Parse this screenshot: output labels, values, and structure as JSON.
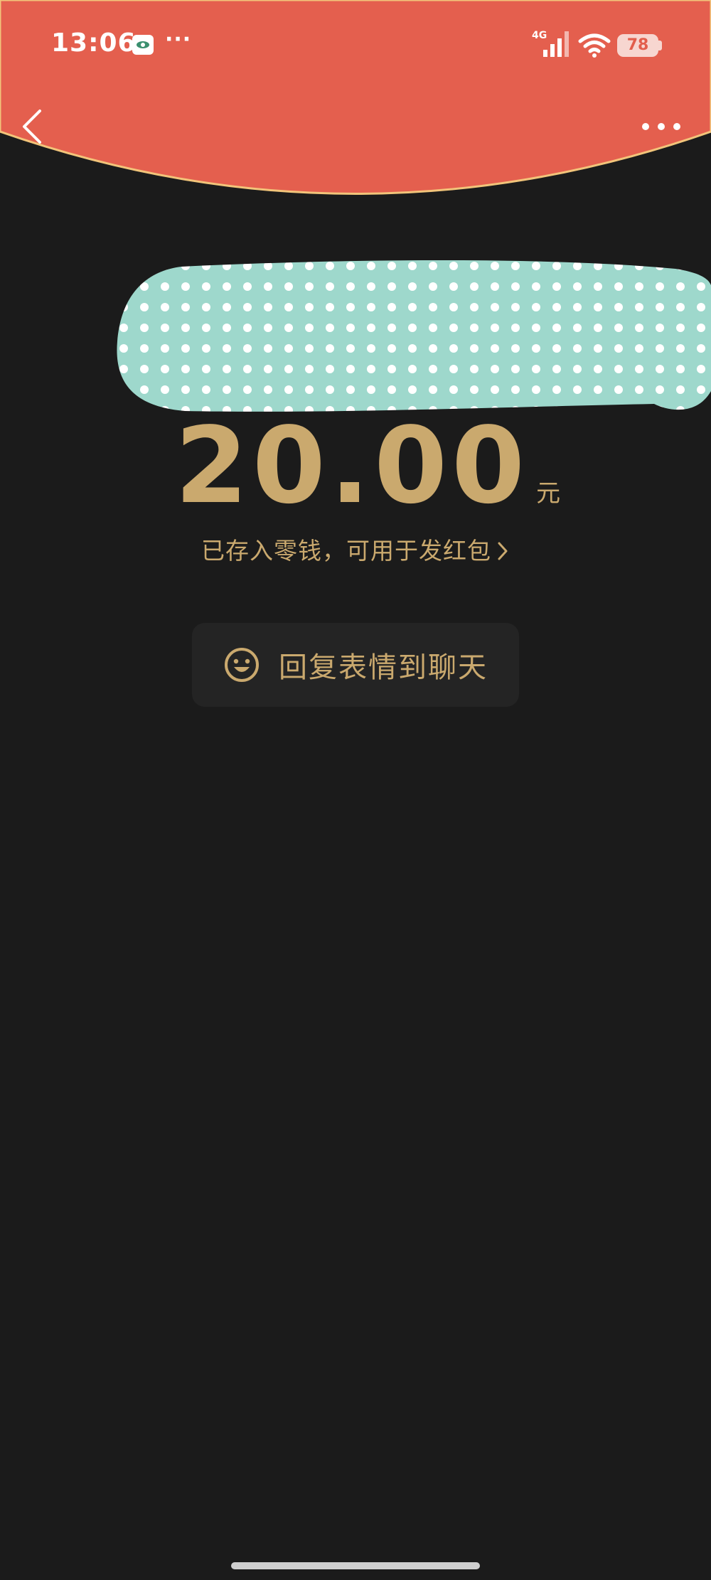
{
  "status_bar": {
    "time": "13:06",
    "app_icon": "message-app-icon",
    "more_dots": "···",
    "network": "4G",
    "signal_icon": "cellular-signal-icon",
    "wifi_icon": "wifi-icon",
    "battery_level": "78"
  },
  "nav": {
    "back_icon": "back-chevron-icon",
    "more_icon": "more-dots-icon"
  },
  "redpacket": {
    "amount": "20.00",
    "currency_unit": "元",
    "stored_note": "已存入零钱，可用于发红包",
    "stored_note_icon": "chevron-right-icon",
    "reply_button_label": "回复表情到聊天",
    "reply_button_icon": "smile-icon"
  },
  "colors": {
    "header_red": "#e45f4e",
    "header_edge": "#f2c47a",
    "gold_text": "#caa96e",
    "background": "#1b1b1b",
    "button_bg": "#242424",
    "redaction_mint": "#9ed8cc"
  }
}
